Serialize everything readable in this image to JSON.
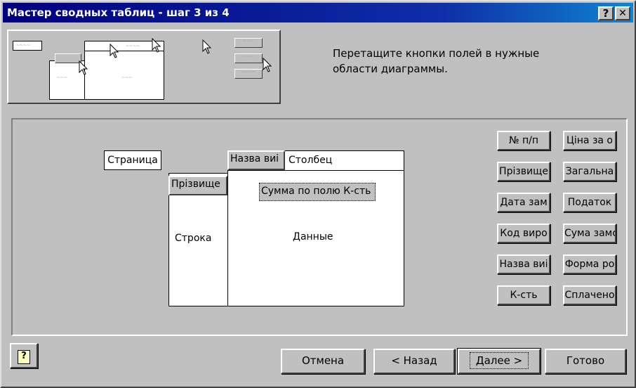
{
  "window": {
    "title": "Мастер сводных таблиц - шаг 3 из 4",
    "help_glyph": "?",
    "close_glyph": "✕"
  },
  "preview": {
    "page_mini": "~~~~",
    "row_mini": "~~~",
    "data_mini": "~~~",
    "col_mini": "~~~~",
    "button_minis": [
      "~~~",
      "~~~",
      "~~~~"
    ]
  },
  "instructions": "Перетащите кнопки полей в нужные области диаграммы.",
  "layout": {
    "page_area": "Страница",
    "column_area": "Столбец",
    "row_area": "Строка",
    "data_area": "Данные",
    "column_field": "Назва виі",
    "row_field": "Прізвище",
    "data_field": "Сумма по полю К-сть"
  },
  "fields": {
    "col1": [
      "№ п/п",
      "Прізвище",
      "Дата зам",
      "Код виро",
      "Назва виі",
      "К-сть"
    ],
    "col2": [
      "Ціна за о",
      "Загальна",
      "Податок",
      "Сума замс",
      "Форма ро",
      "Сплачено"
    ]
  },
  "buttons": {
    "help_glyph": "?",
    "cancel": "Отмена",
    "back": "< Назад",
    "next": "Далее >",
    "finish": "Готово"
  }
}
